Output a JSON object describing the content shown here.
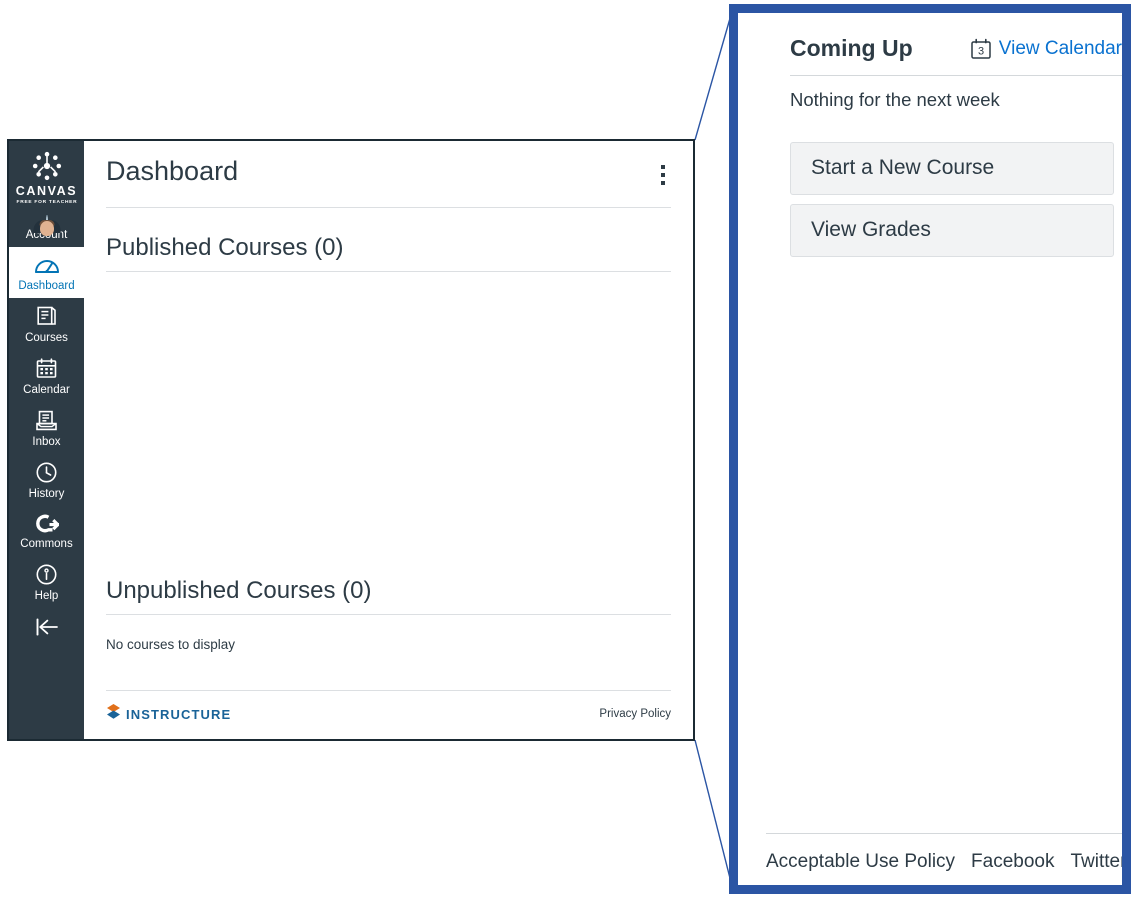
{
  "window": {
    "sidebar": {
      "logo": {
        "name": "canvas-logo",
        "wordmark": "CANVAS",
        "tagline": "FREE FOR TEACHER"
      },
      "items": [
        {
          "label": "Account",
          "icon": "avatar-icon",
          "active": false
        },
        {
          "label": "Dashboard",
          "icon": "dashboard-icon",
          "active": true
        },
        {
          "label": "Courses",
          "icon": "courses-book-icon",
          "active": false
        },
        {
          "label": "Calendar",
          "icon": "calendar-icon",
          "active": false
        },
        {
          "label": "Inbox",
          "icon": "inbox-icon",
          "active": false
        },
        {
          "label": "History",
          "icon": "clock-icon",
          "active": false
        },
        {
          "label": "Commons",
          "icon": "commons-arrow-icon",
          "active": false
        },
        {
          "label": "Help",
          "icon": "help-info-icon",
          "active": false
        }
      ],
      "collapse": {
        "icon": "collapse-left-arrow-icon"
      }
    },
    "header": {
      "title": "Dashboard",
      "options_icon": "kebab-menu-icon"
    },
    "published": {
      "title": "Published Courses (0)"
    },
    "unpublished": {
      "title": "Unpublished Courses (0)",
      "empty_message": "No courses to display"
    },
    "footer": {
      "logo_text": "INSTRUCTURE",
      "logo_icon": "instructure-diamond-icon",
      "privacy_label": "Privacy Policy"
    }
  },
  "callout": {
    "coming_up": {
      "title": "Coming Up",
      "calendar_icon": "calendar-3-icon",
      "calendar_icon_day": "3",
      "view_calendar_label": "View Calendar",
      "empty_message": "Nothing for the next week"
    },
    "buttons": [
      {
        "label": "Start a New Course",
        "name": "start-new-course-button"
      },
      {
        "label": "View Grades",
        "name": "view-grades-button"
      }
    ],
    "footer_links": [
      {
        "label": "Acceptable Use Policy",
        "name": "acceptable-use-policy-link"
      },
      {
        "label": "Facebook",
        "name": "facebook-link"
      },
      {
        "label": "Twitter",
        "name": "twitter-link"
      }
    ]
  },
  "colors": {
    "sidebar_bg": "#2d3b45",
    "accent_blue": "#0374b5",
    "link_blue": "#0a72d0",
    "callout_border": "#2b55a4",
    "instructure_blue": "#1a6398",
    "instructure_orange": "#e1701a",
    "button_bg": "#f2f3f4"
  }
}
